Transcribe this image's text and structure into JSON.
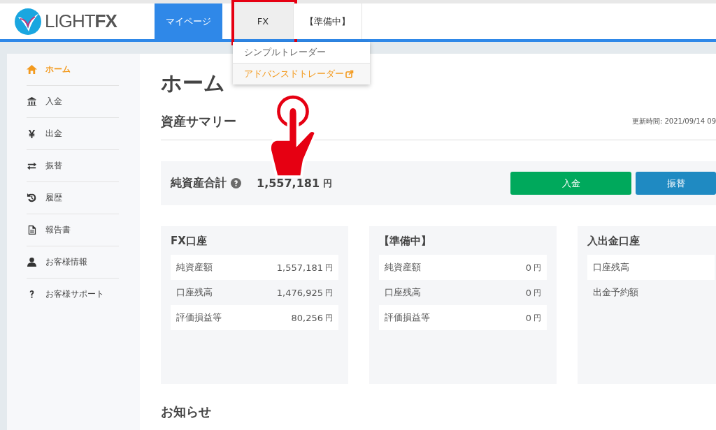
{
  "logo": {
    "text": "LIGHT",
    "accent": "FX"
  },
  "nav": [
    {
      "label": "マイページ",
      "selected": true,
      "highlighted": false
    },
    {
      "label": "FX",
      "selected": false,
      "highlighted": true
    },
    {
      "label": "【準備中】",
      "selected": false,
      "highlighted": false
    }
  ],
  "dropdown": [
    {
      "label": "シンプルトレーダー",
      "external": false
    },
    {
      "label": "アドバンスドトレーダー",
      "external": true
    }
  ],
  "sidebar": [
    {
      "label": "ホーム",
      "selected": true
    },
    {
      "label": "入金",
      "selected": false
    },
    {
      "label": "出金",
      "selected": false
    },
    {
      "label": "振替",
      "selected": false
    },
    {
      "label": "履歴",
      "selected": false
    },
    {
      "label": "報告書",
      "selected": false
    },
    {
      "label": "お客様情報",
      "selected": false
    },
    {
      "label": "お客様サポート",
      "selected": false
    }
  ],
  "page_title": "ホーム",
  "summary": {
    "title": "資産サマリー",
    "updated": "更新時間: 2021/09/14 09",
    "total_label": "純資産合計",
    "total_value": "1,557,181",
    "total_unit": "円",
    "buttons": [
      {
        "label": "入金",
        "kind": "green"
      },
      {
        "label": "振替",
        "kind": "blue"
      }
    ]
  },
  "accounts": [
    {
      "title": "FX口座",
      "rows": [
        {
          "label": "純資産額",
          "value": "1,557,181",
          "unit": "円"
        },
        {
          "label": "口座残高",
          "value": "1,476,925",
          "unit": "円"
        },
        {
          "label": "評価損益等",
          "value": "80,256",
          "unit": "円"
        }
      ]
    },
    {
      "title": "【準備中】",
      "rows": [
        {
          "label": "純資産額",
          "value": "0",
          "unit": "円"
        },
        {
          "label": "口座残高",
          "value": "0",
          "unit": "円"
        },
        {
          "label": "評価損益等",
          "value": "0",
          "unit": "円"
        }
      ]
    },
    {
      "title": "入出金口座",
      "rows": [
        {
          "label": "口座残高"
        },
        {
          "label": "出金予約額"
        }
      ]
    }
  ],
  "news_title": "お知らせ"
}
